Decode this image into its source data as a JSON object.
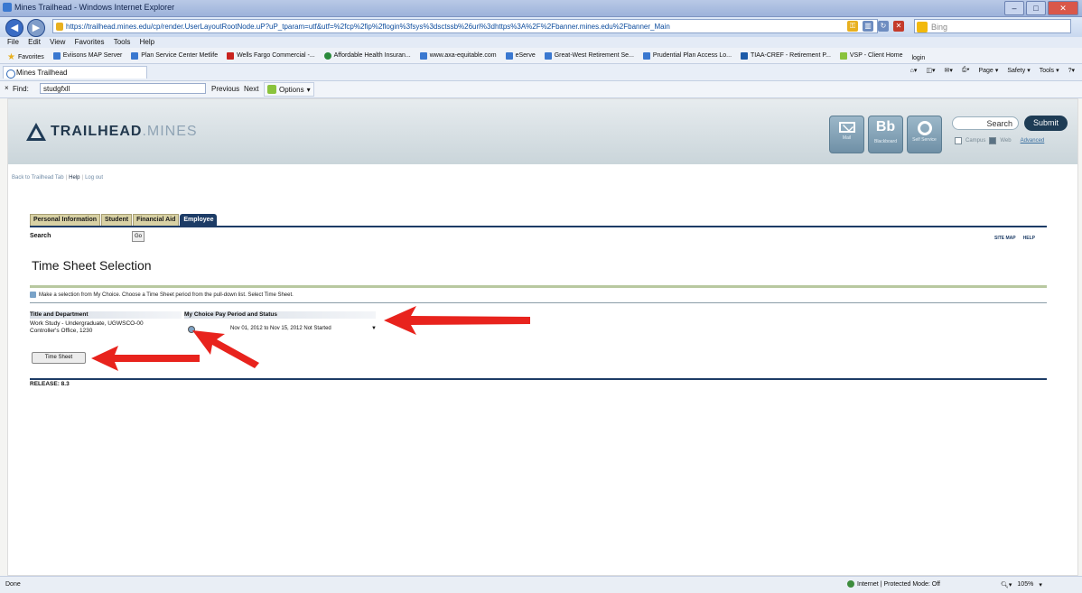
{
  "window": {
    "title": "Mines Trailhead - Windows Internet Explorer"
  },
  "browser": {
    "url": "https://trailhead.mines.edu/cp/render.UserLayoutRootNode.uP?uP_tparam=utf&utf=%2fcp%2fip%2flogin%3fsys%3dsctssb%26url%3dhttps%3A%2F%2Fbanner.mines.edu%2Fbanner_Main",
    "search_placeholder": "Bing",
    "menu": [
      "File",
      "Edit",
      "View",
      "Favorites",
      "Tools",
      "Help"
    ],
    "favorites_label": "Favorites",
    "favorites": [
      "Eviisons MAP Server",
      "Plan Service Center Metlife",
      "Wells Fargo Commercial -...",
      "Affordable Health Insuran...",
      "www.axa-equitable.com",
      "eServe",
      "Great-West Retirement Se...",
      "Prudential Plan Access Lo...",
      "TIAA-CREF - Retirement P...",
      "VSP - Client Home",
      "login"
    ],
    "tab_title": "Mines Trailhead",
    "commands": [
      "Page",
      "Safety",
      "Tools"
    ],
    "find": {
      "close": "×",
      "label": "Find:",
      "value": "studgfxll",
      "prev": "Previous",
      "next": "Next",
      "options": "Options"
    },
    "status": {
      "left": "Done",
      "zone": "Internet | Protected Mode: Off",
      "zoom": "105%"
    }
  },
  "header": {
    "logo_primary": "TRAILHEAD",
    "logo_secondary": ".MINES",
    "icons": [
      {
        "name": "mail",
        "caption": "Mail"
      },
      {
        "name": "blackboard",
        "symbol": "Bb",
        "caption": "Blackboard"
      },
      {
        "name": "self-service",
        "caption": "Self Service"
      }
    ],
    "search_value": "Search",
    "submit_label": "Submit",
    "options": [
      "Campus",
      "Web"
    ],
    "advanced": "Advanced"
  },
  "breadcrumbs": {
    "back": "Back to Trailhead Tab",
    "help": "Help",
    "logout": "Log out"
  },
  "tabs": [
    "Personal Information",
    "Student",
    "Financial Aid",
    "Employee"
  ],
  "active_tab": "Employee",
  "search": {
    "label": "Search",
    "go": "Go"
  },
  "top_links": [
    "SITE MAP",
    "HELP"
  ],
  "page_title": "Time Sheet Selection",
  "instruction": "Make a selection from My Choice. Choose a Time Sheet period from the pull-down list. Select Time Sheet.",
  "table": {
    "headers": [
      "Title and Department",
      "My Choice",
      "Pay Period and Status"
    ],
    "row": {
      "title_line1": "Work Study - Undergraduate, UGWSCO-00",
      "title_line2": "Controller's Office, 1230",
      "period": "Nov 01, 2012 to Nov 15, 2012 Not Started"
    }
  },
  "button_label": "Time Sheet",
  "release": "RELEASE: 8.3",
  "colors": {
    "navy": "#1d3c66",
    "tab_tan": "#d8d1a4",
    "annotation_red": "#e8231d"
  }
}
